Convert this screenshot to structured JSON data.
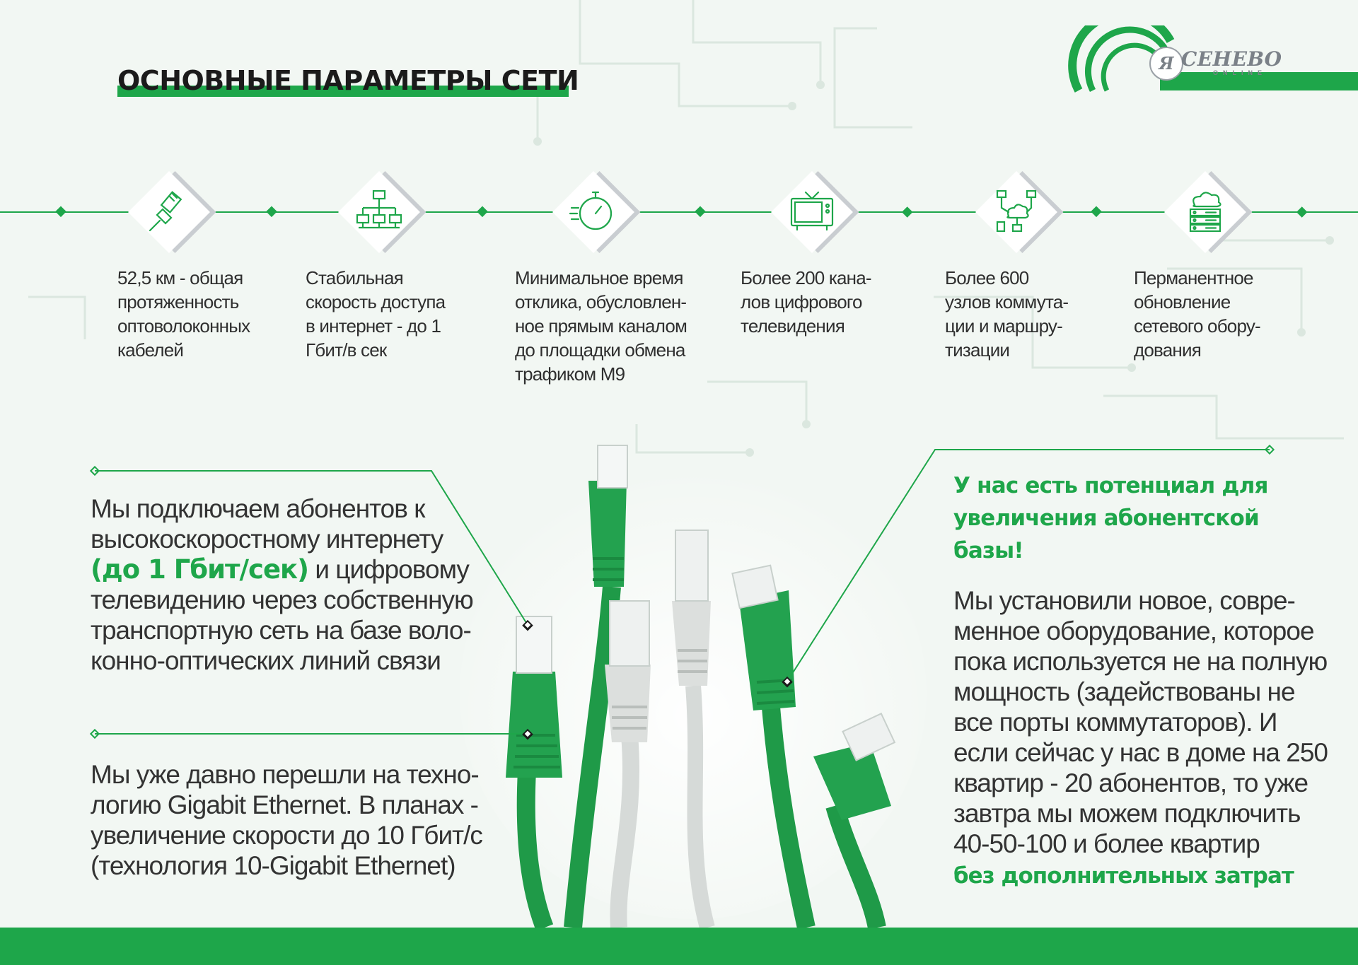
{
  "title": "ОСНОВНЫЕ ПАРАМЕТРЫ СЕТИ",
  "logo": {
    "mark": "Я",
    "name": "СЕНЕВО",
    "sub": "ONLINE"
  },
  "params": [
    {
      "icon": "ethernet-plug-icon",
      "lines": [
        "52,5 км - общая",
        "протяженность",
        "оптоволоконных",
        "кабелей"
      ]
    },
    {
      "icon": "network-topology-icon",
      "lines": [
        "Стабильная",
        "скорость доступа",
        "в интернет - до 1",
        "Гбит/в сек"
      ]
    },
    {
      "icon": "stopwatch-speed-icon",
      "lines": [
        "Минимальное время",
        "отклика, обусловлен-",
        "ное прямым каналом",
        "до площадки обмена",
        "трафиком M9"
      ]
    },
    {
      "icon": "tv-icon",
      "lines": [
        "Более 200 кана-",
        "лов цифрового",
        "телевидения"
      ]
    },
    {
      "icon": "cloud-network-icon",
      "lines": [
        "Более 600",
        "узлов коммута-",
        "ции и маршру-",
        "тизации"
      ]
    },
    {
      "icon": "cloud-server-icon",
      "lines": [
        "Перманентное",
        "обновление",
        "сетевого обору-",
        "дования"
      ]
    }
  ],
  "left_block_1": {
    "lines_before": [
      "Мы подключаем абонентов к",
      "высокоскоростному интернету"
    ],
    "highlight": "(до 1 Гбит/сек)",
    "after_highlight": " и цифровому",
    "lines_after": [
      "телевидению через собственную",
      "транспортную сеть на базе воло-",
      "конно-оптических линий связи"
    ]
  },
  "left_block_2": {
    "lines": [
      "Мы уже давно перешли на техно-",
      "логию Gigabit Ethernet. В планах -",
      "увеличение скорости до 10 Гбит/с",
      "(технология 10-Gigabit Ethernet)"
    ]
  },
  "right_block": {
    "headline_lines": [
      "У нас есть потенциал для",
      "увеличения абонентской",
      "базы!"
    ],
    "lines": [
      "Мы установили новое, совре-",
      "менное оборудование, которое",
      "пока используется не на полную",
      "мощность (задействованы не",
      "все порты коммутаторов). И",
      "если сейчас у нас в доме на 250",
      "квартир - 20 абонентов, то уже",
      "завтра мы можем подключить",
      "40-50-100 и более квартир"
    ],
    "highlight": "без дополнительных затрат"
  },
  "colors": {
    "accent": "#1ea64a",
    "text": "#2f2f2f",
    "logo_gray": "#7b8188",
    "background": "#f2f7f3"
  }
}
